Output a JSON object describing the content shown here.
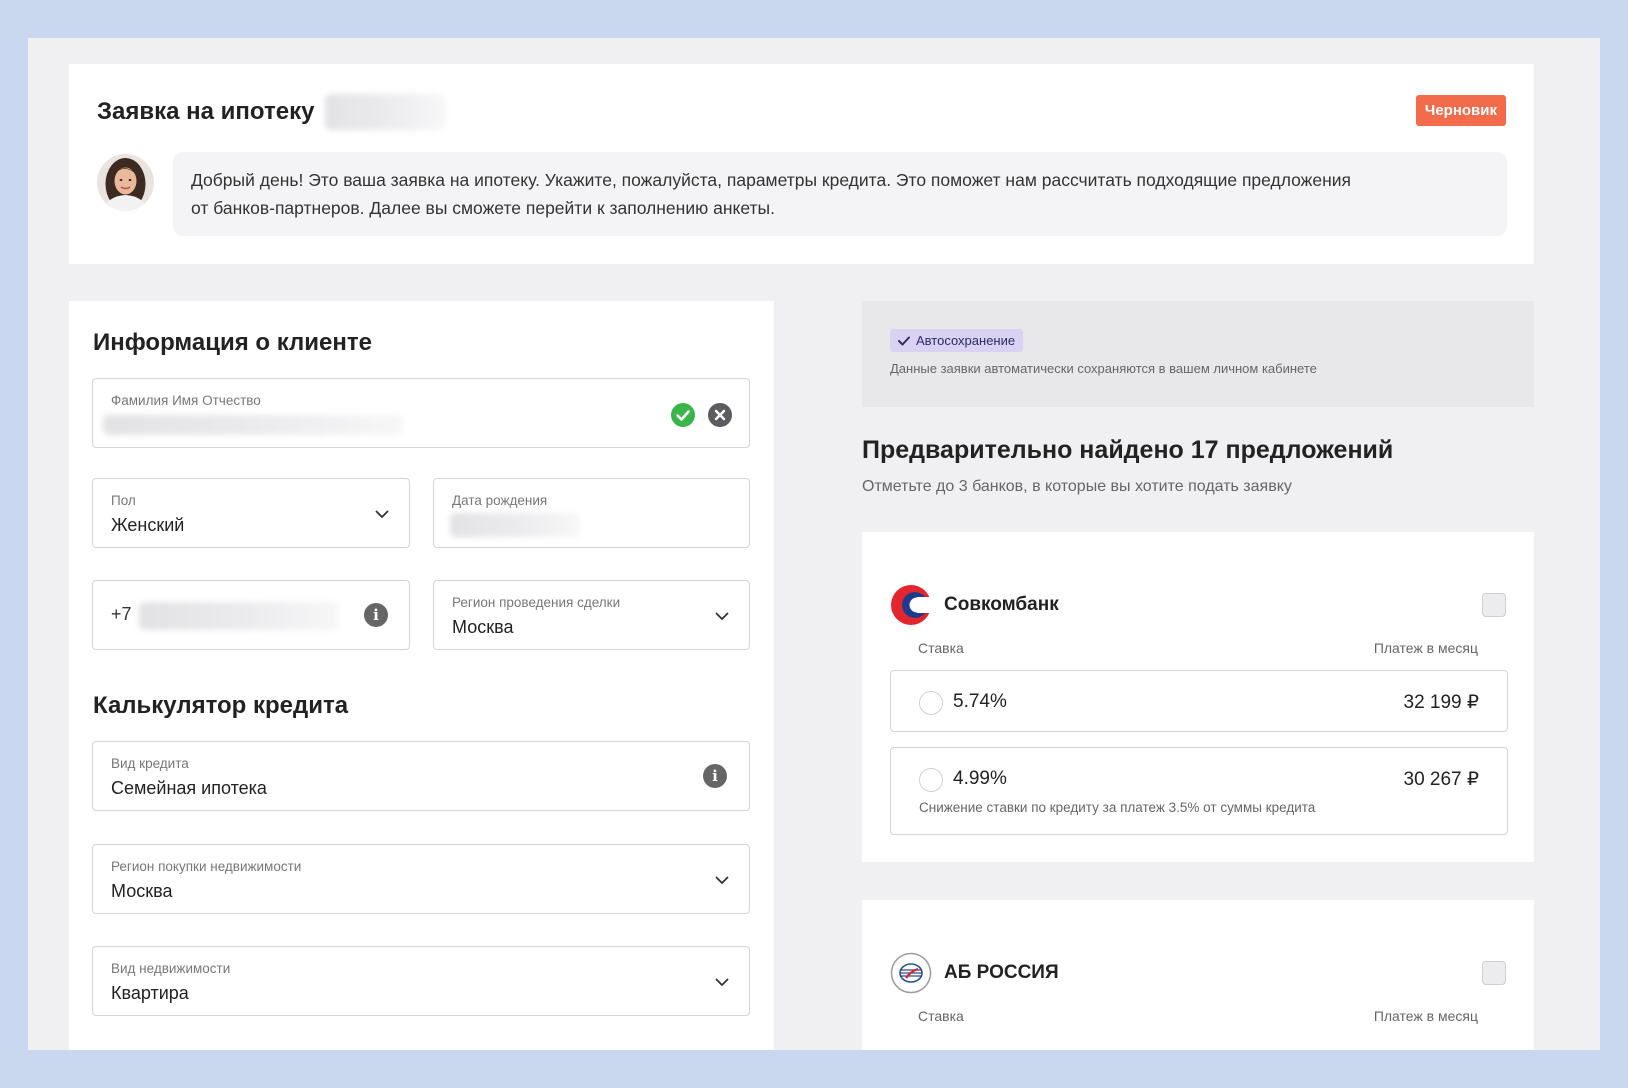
{
  "header": {
    "title": "Заявка на ипотеку",
    "status_badge": "Черновик",
    "greeting_line1": "Добрый день! Это ваша заявка на ипотеку. Укажите, пожалуйста, параметры кредита. Это поможет нам рассчитать подходящие предложения",
    "greeting_line2": "от банков-партнеров. Далее вы сможете перейти к заполнению анкеты."
  },
  "client": {
    "section_title": "Информация о клиенте",
    "full_name": {
      "label": "Фамилия Имя Отчество",
      "value": ""
    },
    "gender": {
      "label": "Пол",
      "value": "Женский"
    },
    "birth_date": {
      "label": "Дата рождения",
      "value": ""
    },
    "phone": {
      "prefix": "+7",
      "value": ""
    },
    "deal_region": {
      "label": "Регион проведения сделки",
      "value": "Москва"
    }
  },
  "calculator": {
    "section_title": "Калькулятор кредита",
    "loan_type": {
      "label": "Вид кредита",
      "value": "Семейная ипотека"
    },
    "property_region": {
      "label": "Регион покупки недвижимости",
      "value": "Москва"
    },
    "property_type": {
      "label": "Вид недвижимости",
      "value": "Квартира"
    }
  },
  "autosave": {
    "badge": "Автосохранение",
    "text": "Данные заявки автоматически сохраняются в вашем личном кабинете"
  },
  "offers": {
    "title": "Предварительно найдено 17 предложений",
    "subtitle": "Отметьте до 3 банков, в которые вы хотите подать заявку",
    "banks": [
      {
        "name": "Совкомбанк",
        "rate_label": "Ставка",
        "payment_label": "Платеж в месяц",
        "options": [
          {
            "rate": "5.74%",
            "payment": "32 199 ₽",
            "note": ""
          },
          {
            "rate": "4.99%",
            "payment": "30 267 ₽",
            "note": "Снижение ставки по кредиту за платеж 3.5% от суммы кредита"
          }
        ]
      },
      {
        "name": "АБ РОССИЯ",
        "rate_label": "Ставка",
        "payment_label": "Платеж в месяц",
        "options": []
      }
    ]
  },
  "colors": {
    "background": "#c9d7ef",
    "draft_badge": "#f26b4a",
    "autosave_badge": "#d9d2f3",
    "valid_check": "#3ab54a",
    "sovcombank_red": "#e3262e",
    "sovcombank_blue": "#1f3b8c"
  }
}
